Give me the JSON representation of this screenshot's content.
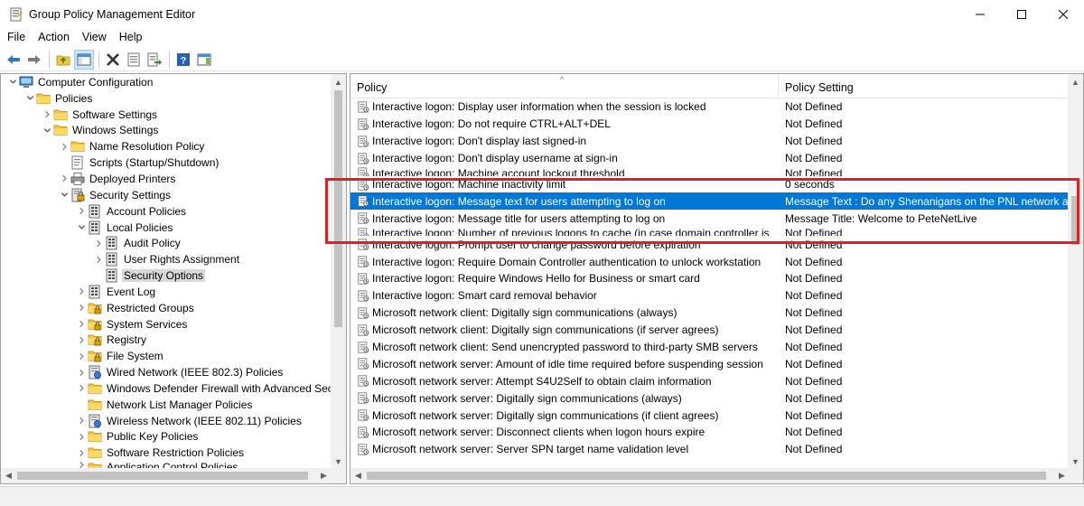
{
  "window": {
    "title": "Group Policy Management Editor",
    "controls": {
      "minimize": "—",
      "maximize": "☐",
      "close": "✕"
    }
  },
  "menu": [
    "File",
    "Action",
    "View",
    "Help"
  ],
  "toolbar": {
    "icons": [
      "back-arrow-icon",
      "forward-arrow-icon",
      "up-folder-icon",
      "show-hide-tree-icon",
      "delete-icon",
      "properties-icon",
      "export-list-icon",
      "help-icon",
      "show-action-pane-icon"
    ]
  },
  "tree": {
    "items": [
      {
        "label": "Computer Configuration",
        "level": 0,
        "expander": "open",
        "icon": "computer"
      },
      {
        "label": "Policies",
        "level": 1,
        "expander": "open",
        "icon": "folder"
      },
      {
        "label": "Software Settings",
        "level": 2,
        "expander": "closed",
        "icon": "folder"
      },
      {
        "label": "Windows Settings",
        "level": 2,
        "expander": "open",
        "icon": "folder"
      },
      {
        "label": "Name Resolution Policy",
        "level": 3,
        "expander": "closed",
        "icon": "folder"
      },
      {
        "label": "Scripts (Startup/Shutdown)",
        "level": 3,
        "expander": "none",
        "icon": "script"
      },
      {
        "label": "Deployed Printers",
        "level": 3,
        "expander": "closed",
        "icon": "printer"
      },
      {
        "label": "Security Settings",
        "level": 3,
        "expander": "open",
        "icon": "security"
      },
      {
        "label": "Account Policies",
        "level": 4,
        "expander": "closed",
        "icon": "policy"
      },
      {
        "label": "Local Policies",
        "level": 4,
        "expander": "open",
        "icon": "policy"
      },
      {
        "label": "Audit Policy",
        "level": 5,
        "expander": "closed",
        "icon": "policy"
      },
      {
        "label": "User Rights Assignment",
        "level": 5,
        "expander": "closed",
        "icon": "policy"
      },
      {
        "label": "Security Options",
        "level": 5,
        "expander": "none",
        "icon": "policy",
        "selected": true
      },
      {
        "label": "Event Log",
        "level": 4,
        "expander": "closed",
        "icon": "policy"
      },
      {
        "label": "Restricted Groups",
        "level": 4,
        "expander": "closed",
        "icon": "folder-lock"
      },
      {
        "label": "System Services",
        "level": 4,
        "expander": "closed",
        "icon": "folder-lock"
      },
      {
        "label": "Registry",
        "level": 4,
        "expander": "closed",
        "icon": "folder-lock"
      },
      {
        "label": "File System",
        "level": 4,
        "expander": "closed",
        "icon": "folder-lock"
      },
      {
        "label": "Wired Network (IEEE 802.3) Policies",
        "level": 4,
        "expander": "closed",
        "icon": "network"
      },
      {
        "label": "Windows Defender Firewall with Advanced Sec",
        "level": 4,
        "expander": "closed",
        "icon": "folder"
      },
      {
        "label": "Network List Manager Policies",
        "level": 4,
        "expander": "none",
        "icon": "folder"
      },
      {
        "label": "Wireless Network (IEEE 802.11) Policies",
        "level": 4,
        "expander": "closed",
        "icon": "network"
      },
      {
        "label": "Public Key Policies",
        "level": 4,
        "expander": "closed",
        "icon": "folder"
      },
      {
        "label": "Software Restriction Policies",
        "level": 4,
        "expander": "closed",
        "icon": "folder"
      },
      {
        "label": "Application Control Policies",
        "level": 4,
        "expander": "closed",
        "icon": "folder",
        "partial": true
      }
    ]
  },
  "list": {
    "columns": {
      "policy": "Policy",
      "setting": "Policy Setting"
    },
    "rows": [
      {
        "policy": "Interactive logon: Display user information when the session is locked",
        "setting": "Not Defined"
      },
      {
        "policy": "Interactive logon: Do not require CTRL+ALT+DEL",
        "setting": "Not Defined"
      },
      {
        "policy": "Interactive logon: Don't display last signed-in",
        "setting": "Not Defined"
      },
      {
        "policy": "Interactive logon: Don't display username at sign-in",
        "setting": "Not Defined"
      },
      {
        "policy": "Interactive logon: Machine account lockout threshold",
        "setting": "Not Defined",
        "partial": true
      },
      {
        "policy": "Interactive logon: Machine inactivity limit",
        "setting": "0 seconds"
      },
      {
        "policy": "Interactive logon: Message text for users attempting to log on",
        "setting": "Message Text :  Do any Shenanigans on the PNL network an",
        "selected": true
      },
      {
        "policy": "Interactive logon: Message title for users attempting to log on",
        "setting": "Message Title: Welcome to PeteNetLive"
      },
      {
        "policy": "Interactive logon: Number of previous logons to cache (in case domain controller is",
        "setting": "Not Defined",
        "partial": true
      },
      {
        "policy": "Interactive logon: Prompt user to change password before expiration",
        "setting": "Not Defined"
      },
      {
        "policy": "Interactive logon: Require Domain Controller authentication to unlock workstation",
        "setting": "Not Defined"
      },
      {
        "policy": "Interactive logon: Require Windows Hello for Business or smart card",
        "setting": "Not Defined"
      },
      {
        "policy": "Interactive logon: Smart card removal behavior",
        "setting": "Not Defined"
      },
      {
        "policy": "Microsoft network client: Digitally sign communications (always)",
        "setting": "Not Defined"
      },
      {
        "policy": "Microsoft network client: Digitally sign communications (if server agrees)",
        "setting": "Not Defined"
      },
      {
        "policy": "Microsoft network client: Send unencrypted password to third-party SMB servers",
        "setting": "Not Defined"
      },
      {
        "policy": "Microsoft network server: Amount of idle time required before suspending session",
        "setting": "Not Defined"
      },
      {
        "policy": "Microsoft network server: Attempt S4U2Self to obtain claim information",
        "setting": "Not Defined"
      },
      {
        "policy": "Microsoft network server: Digitally sign communications (always)",
        "setting": "Not Defined"
      },
      {
        "policy": "Microsoft network server: Digitally sign communications (if client agrees)",
        "setting": "Not Defined"
      },
      {
        "policy": "Microsoft network server: Disconnect clients when logon hours expire",
        "setting": "Not Defined"
      },
      {
        "policy": "Microsoft network server: Server SPN target name validation level",
        "setting": "Not Defined"
      }
    ]
  },
  "colors": {
    "selection": "#0078d7",
    "highlight_box": "#e41e1e",
    "folder": "#f5c542"
  }
}
